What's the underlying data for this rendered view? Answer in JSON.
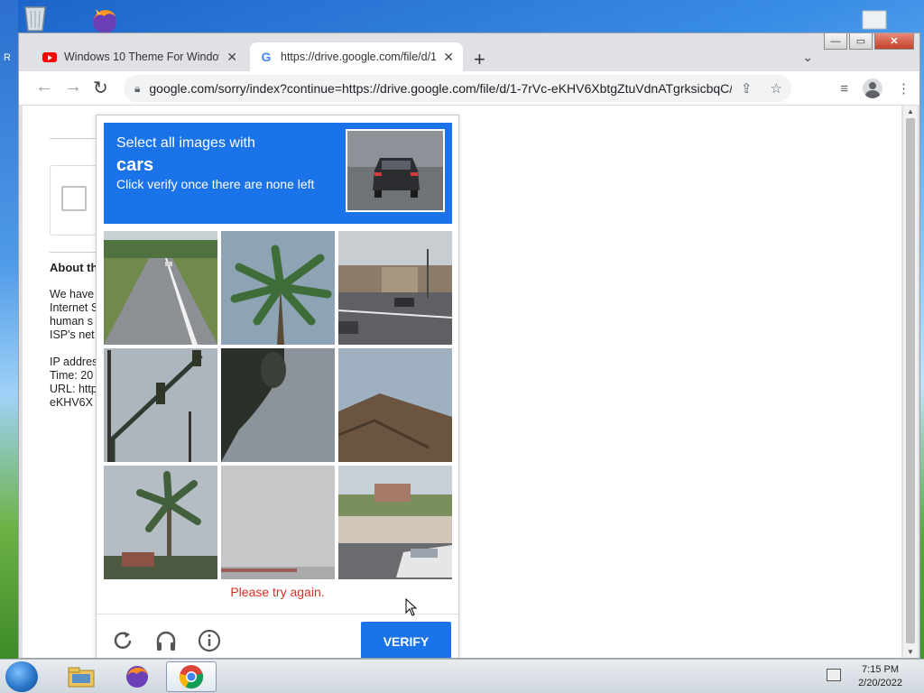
{
  "desktop": {
    "left_glyph": "R"
  },
  "browser": {
    "tabs": [
      {
        "title": "Windows 10 Theme For Windows",
        "icon": "youtube-icon",
        "active": false
      },
      {
        "title": "https://drive.google.com/file/d/1",
        "icon": "google-icon",
        "active": true
      }
    ],
    "new_tab": "+",
    "address": "google.com/sorry/index?continue=https://drive.google.com/file/d/1-7rVc-eKHV6XbtgZtuVdnATgrksicbqC/...",
    "window_buttons": {
      "minimize": "—",
      "maximize": "▭",
      "close": "✕"
    }
  },
  "background_page": {
    "heading": "About th",
    "lines": [
      "We have",
      "Internet S",
      "human s",
      "ISP's net",
      "",
      "IP addres",
      "Time: 20",
      "URL: http",
      "eKHV6X"
    ]
  },
  "captcha": {
    "instruction_line1": "Select all images with",
    "target_object": "cars",
    "instruction_line2": "Click verify once there are none left",
    "retry_message": "Please try again.",
    "verify_label": "VERIFY",
    "tiles": [
      "road-with-car",
      "palm-tree",
      "street-intersection",
      "traffic-lights",
      "tree-close-up",
      "building-roof",
      "palm-tree-2",
      "overcast-sky",
      "parked-car-street"
    ],
    "colors": {
      "header_bg": "#1a73e8",
      "verify_bg": "#1a73e8",
      "error_text": "#d93025"
    }
  },
  "taskbar": {
    "apps": [
      "file-explorer",
      "firefox",
      "chrome"
    ],
    "active_app": "chrome",
    "time": "7:15 PM",
    "date": "2/20/2022"
  }
}
